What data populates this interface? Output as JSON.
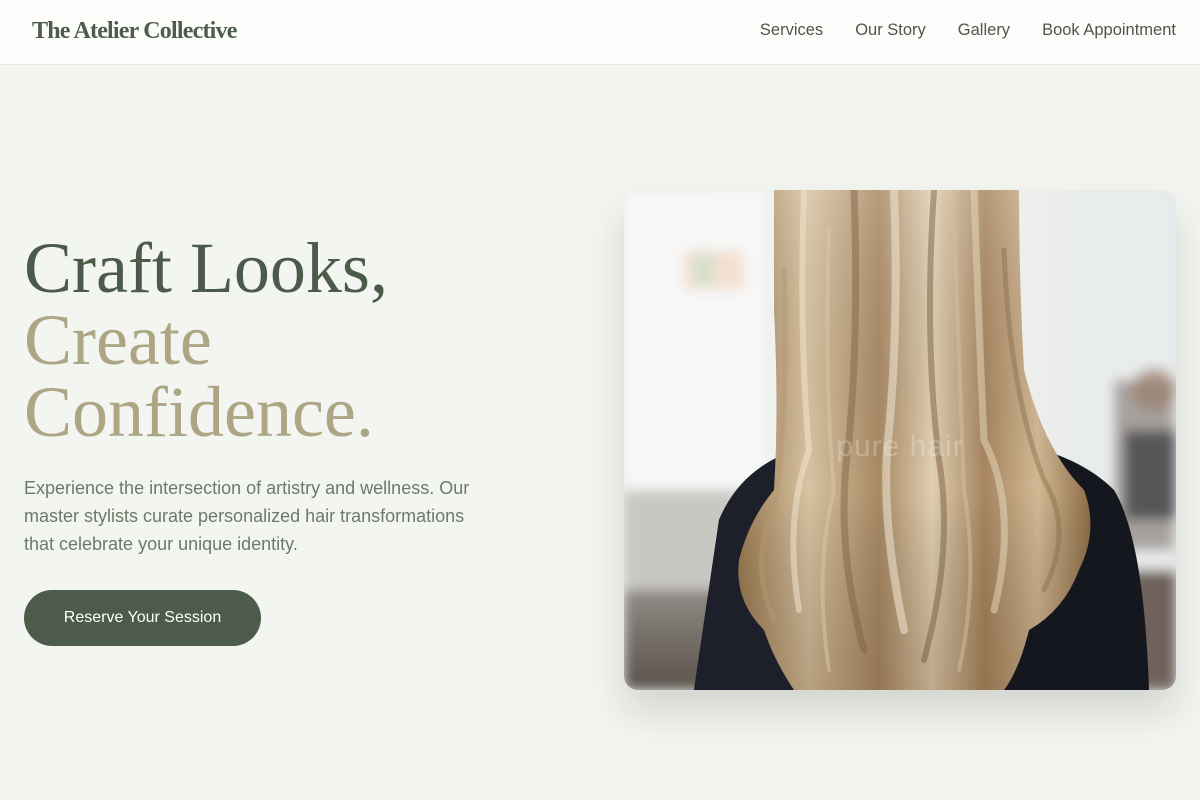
{
  "header": {
    "brand": "The Atelier Collective",
    "nav": [
      "Services",
      "Our Story",
      "Gallery",
      "Book Appointment"
    ]
  },
  "hero": {
    "headline": [
      "Craft Looks,",
      "Create",
      "Confidence."
    ],
    "intro": "Experience the intersection of artistry and wellness. Our master stylists curate personalized hair transformations that celebrate your unique identity.",
    "cta_label": "Reserve Your Session",
    "image": {
      "subject": "long wavy balayage blonde hair, back view",
      "watermark": "pure hair"
    }
  },
  "colors": {
    "background": "#f3f5f0",
    "header_bg": "#fdfefc",
    "primary": "#4d5b4a",
    "accent": "#ada685",
    "body_text": "#6d7a69"
  }
}
